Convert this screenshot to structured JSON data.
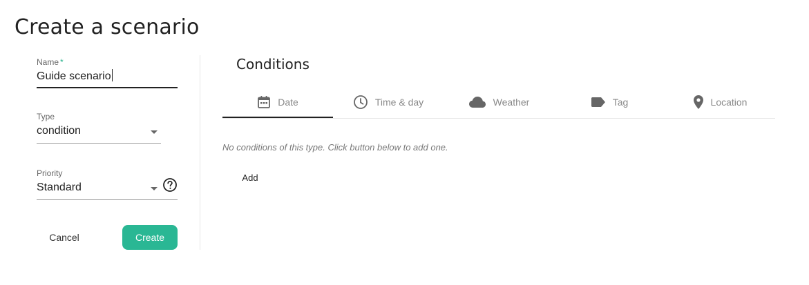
{
  "page": {
    "title": "Create a scenario"
  },
  "form": {
    "name": {
      "label": "Name",
      "required_mark": "*",
      "value": "Guide scenario"
    },
    "type": {
      "label": "Type",
      "value": "condition"
    },
    "priority": {
      "label": "Priority",
      "value": "Standard"
    },
    "cancel_label": "Cancel",
    "create_label": "Create"
  },
  "conditions": {
    "title": "Conditions",
    "tabs": [
      {
        "label": "Date",
        "icon": "calendar-icon",
        "active": true
      },
      {
        "label": "Time & day",
        "icon": "clock-icon",
        "active": false
      },
      {
        "label": "Weather",
        "icon": "cloud-icon",
        "active": false
      },
      {
        "label": "Tag",
        "icon": "tag-icon",
        "active": false
      },
      {
        "label": "Location",
        "icon": "location-pin-icon",
        "active": false
      }
    ],
    "empty_message": "No conditions of this type. Click button below to add one.",
    "add_label": "Add"
  },
  "colors": {
    "accent": "#2ab794",
    "required": "#2ab38e",
    "text": "#222222",
    "muted": "#888888"
  }
}
